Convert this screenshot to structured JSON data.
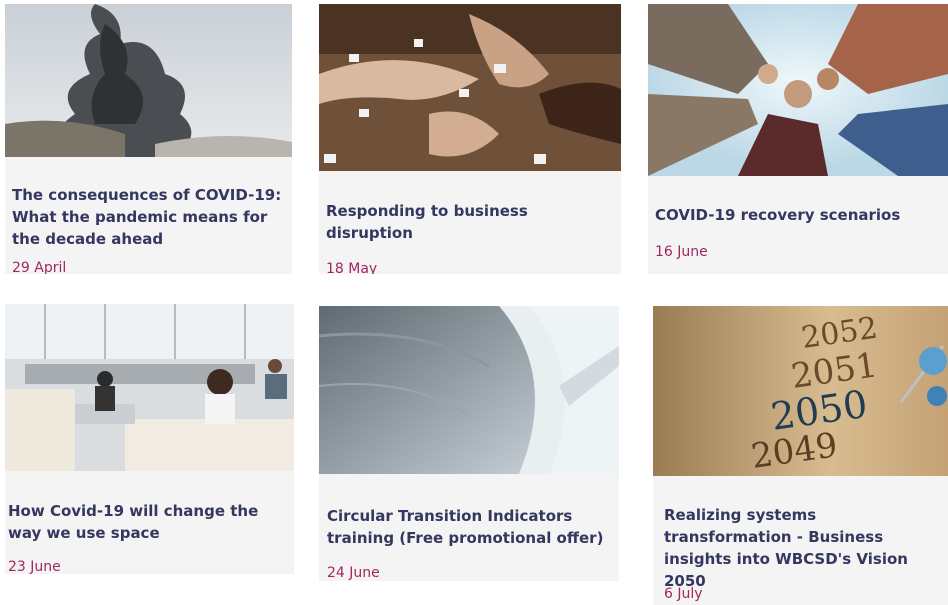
{
  "cards": [
    {
      "title_lines": [
        "The consequences of COVID-19:",
        "What the pandemic means for",
        "the decade ahead"
      ],
      "date": "29 April",
      "image": "volcanic-ash-cloud"
    },
    {
      "title_lines": [
        "Responding to business",
        "disruption"
      ],
      "date": "18 May",
      "image": "hands-holding-puzzle-pieces"
    },
    {
      "title_lines": [
        "COVID-19 recovery scenarios"
      ],
      "date": "16 June",
      "image": "circle-of-joined-hands"
    },
    {
      "title_lines": [
        "How Covid-19 will change the",
        "way we use space"
      ],
      "date": "23 June",
      "image": "open-plan-office"
    },
    {
      "title_lines": [
        "Circular Transition Indicators",
        "training (Free promotional offer)"
      ],
      "date": "24 June",
      "image": "curved-architecture"
    },
    {
      "title_lines": [
        "Realizing systems",
        "transformation - Business",
        "insights into WBCSD's Vision 2050"
      ],
      "date": "6 July",
      "image": "timeline-years-with-pin"
    }
  ],
  "timeline_years": [
    "2052",
    "2051",
    "2050",
    "2049"
  ],
  "colors": {
    "title": "#34375f",
    "date": "#a2275f",
    "card_bg": "#f4f4f4"
  }
}
